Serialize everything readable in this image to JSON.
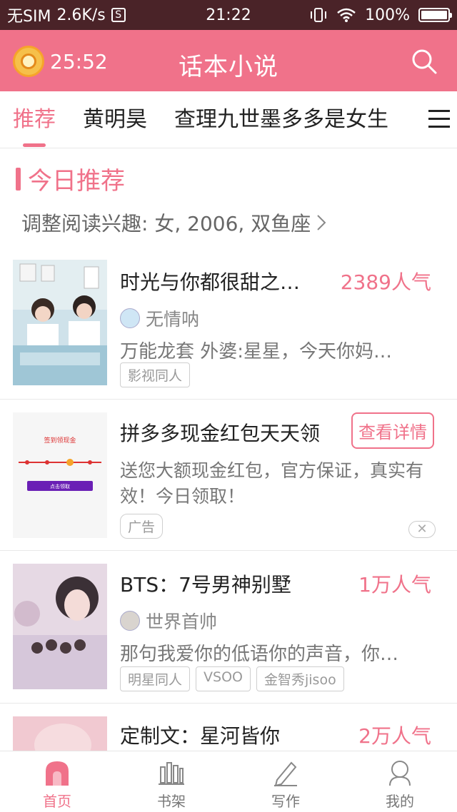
{
  "status_bar": {
    "carrier": "无SIM",
    "speed": "2.6K/s",
    "sim_icon_label": "S",
    "time": "21:22",
    "battery": "100%"
  },
  "header": {
    "timer": "25:52",
    "title": "话本小说",
    "search_icon": "search-icon",
    "timer_icon": "gold-clock-icon"
  },
  "tabs": {
    "items": [
      "推荐",
      "黄明昊",
      "查理九世墨多多是女生"
    ],
    "active_index": 0,
    "menu_icon": "menu-icon"
  },
  "section": {
    "title": "今日推荐",
    "interest": "调整阅读兴趣: 女, 2006, 双鱼座",
    "interest_chevron": "chevron-right-icon"
  },
  "items": [
    {
      "title": "时光与你都很甜之…",
      "popularity": "2389人气",
      "author": "无情呐",
      "desc": "万能龙套 外婆:星星，今天你妈…",
      "tags": [
        "影视同人"
      ]
    },
    {
      "title": "拼多多现金红包天天领",
      "detail_button": "查看详情",
      "desc": "送您大额现金红包，官方保证，真实有效！今日领取！",
      "tags": [
        "广告"
      ],
      "close_symbol": "✕",
      "cover_text": [
        "签到领现金",
        "点击领取"
      ]
    },
    {
      "title": "BTS：7号男神别墅",
      "popularity": "1万人气",
      "author": "世界首帅",
      "desc": "那句我爱你的低语你的声音，你…",
      "tags": [
        "明星同人",
        "VSOO",
        "金智秀jisoo"
      ]
    },
    {
      "title": "定制文：星河皆你",
      "popularity": "2万人气"
    }
  ],
  "bottom_nav": {
    "items": [
      {
        "label": "首页",
        "icon": "home-icon"
      },
      {
        "label": "书架",
        "icon": "bookshelf-icon"
      },
      {
        "label": "写作",
        "icon": "pencil-icon"
      },
      {
        "label": "我的",
        "icon": "profile-icon"
      }
    ],
    "active_index": 0
  },
  "colors": {
    "accent": "#f0728a",
    "status_bar": "#4a2328",
    "text": "#222222",
    "muted": "#777777"
  }
}
